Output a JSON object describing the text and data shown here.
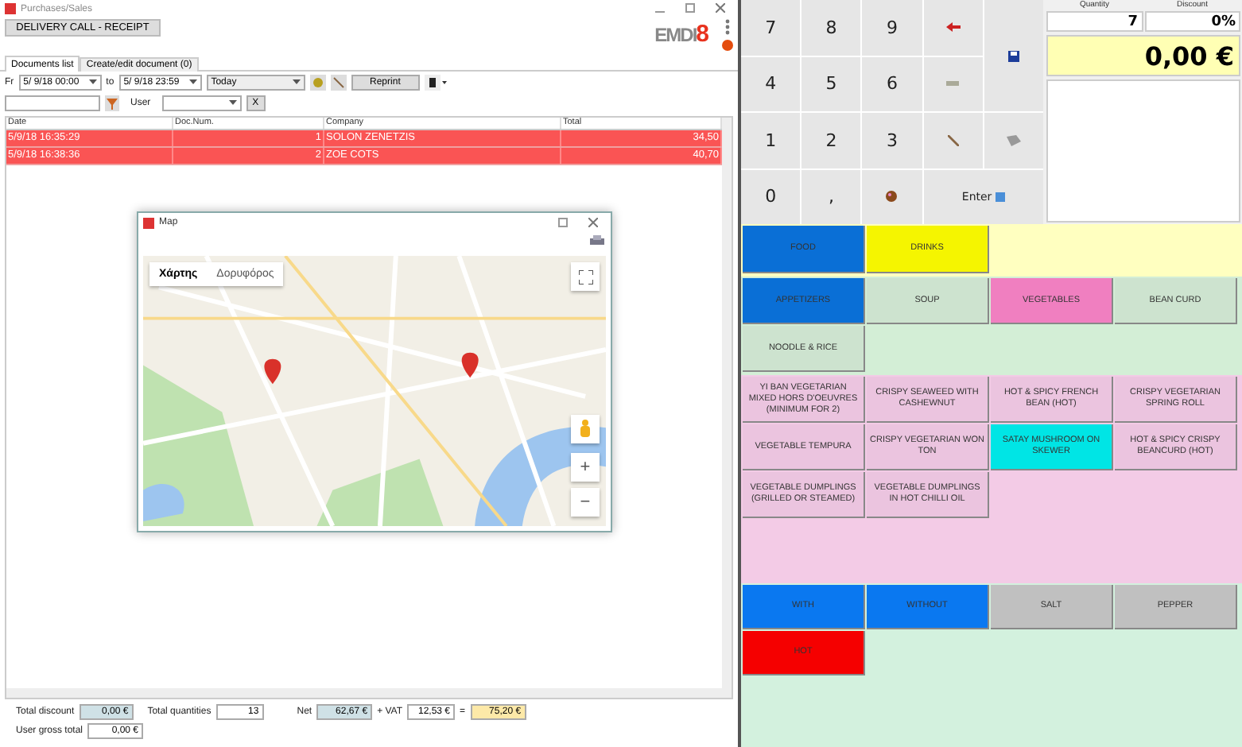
{
  "window": {
    "title": "Purchases/Sales"
  },
  "toolbar": {
    "action_button": "DELIVERY CALL - RECEIPT",
    "logo_text": "EMDI",
    "logo_digit": "8"
  },
  "tabs": [
    {
      "label": "Documents list",
      "selected": true
    },
    {
      "label": "Create/edit document (0)",
      "selected": false
    }
  ],
  "filter": {
    "from_label": "Fr",
    "from": "5/ 9/18 00:00",
    "to_label": "to",
    "to": "5/ 9/18 23:59",
    "period": "Today",
    "reprint": "Reprint",
    "user_label": "User",
    "clear": "X"
  },
  "table": {
    "columns": [
      "Date",
      "Doc.Num.",
      "Company",
      "Total"
    ],
    "rows": [
      {
        "cells": [
          "5/9/18 16:35:29",
          "1",
          "SOLON ZENETZIS",
          "34,50"
        ],
        "selected": true
      },
      {
        "cells": [
          "5/9/18 16:38:36",
          "2",
          "ZOE COTS",
          "40,70"
        ],
        "selected": true
      }
    ]
  },
  "totals": {
    "discount_label": "Total discount",
    "discount": "0,00 €",
    "quantities_label": "Total quantities",
    "quantities": "13",
    "net_label": "Net",
    "net": "62,67 €",
    "vat_label": "+ VAT",
    "vat": "12,53 €",
    "equals": "=",
    "total": "75,20 €",
    "user_gross_label": "User gross total",
    "user_gross": "0,00 €"
  },
  "map_dialog": {
    "title": "Map",
    "map_types": [
      {
        "label": "Χάρτης",
        "selected": true
      },
      {
        "label": "Δορυφόρος",
        "selected": false
      }
    ],
    "zoom_in": "+",
    "zoom_out": "−"
  },
  "keypad": {
    "keys": [
      {
        "kind": "text",
        "label": "7"
      },
      {
        "kind": "text",
        "label": "8"
      },
      {
        "kind": "text",
        "label": "9"
      },
      {
        "kind": "icon"
      },
      {
        "kind": "icon"
      },
      {
        "kind": "text",
        "label": "4"
      },
      {
        "kind": "text",
        "label": "5"
      },
      {
        "kind": "text",
        "label": "6"
      },
      {
        "kind": "icon"
      },
      {
        "kind": "text",
        "label": "1"
      },
      {
        "kind": "text",
        "label": "2"
      },
      {
        "kind": "text",
        "label": "3"
      },
      {
        "kind": "icon"
      },
      {
        "kind": "icon"
      },
      {
        "kind": "text",
        "label": "0"
      },
      {
        "kind": "text",
        "label": ","
      },
      {
        "kind": "icon"
      },
      {
        "kind": "enter",
        "label": "Enter"
      }
    ]
  },
  "order": {
    "quantity_label": "Quantity",
    "quantity": "7",
    "discount_label": "Discount",
    "discount": "0%",
    "amount": "0,00 €"
  },
  "groups": [
    {
      "label": "FOOD",
      "color": "#0a6fd6"
    },
    {
      "label": "DRINKS",
      "color": "#f5f500"
    }
  ],
  "categories": [
    {
      "label": "APPETIZERS",
      "color": "#0a6fd6"
    },
    {
      "label": "SOUP",
      "color": "#cde3cf"
    },
    {
      "label": "VEGETABLES",
      "color": "#f07fc0"
    },
    {
      "label": "BEAN CURD",
      "color": "#cde3cf"
    },
    {
      "label": "NOODLE & RICE",
      "color": "#cde3cf"
    }
  ],
  "products": [
    {
      "label": "YI BAN VEGETARIAN MIXED HORS D'OEUVRES (MINIMUM FOR 2)",
      "color": "#ebc4df"
    },
    {
      "label": "CRISPY SEAWEED WITH CASHEWNUT",
      "color": "#ebc4df"
    },
    {
      "label": "HOT & SPICY FRENCH BEAN (HOT)",
      "color": "#ebc4df"
    },
    {
      "label": "CRISPY VEGETARIAN SPRING ROLL",
      "color": "#ebc4df"
    },
    {
      "label": "VEGETABLE TEMPURA",
      "color": "#ebc4df"
    },
    {
      "label": "CRISPY VEGETARIAN WON TON",
      "color": "#ebc4df"
    },
    {
      "label": "SATAY MUSHROOM ON SKEWER",
      "color": "#00e5e5"
    },
    {
      "label": "HOT & SPICY CRISPY BEANCURD (HOT)",
      "color": "#ebc4df"
    },
    {
      "label": "VEGETABLE DUMPLINGS (GRILLED OR STEAMED)",
      "color": "#ebc4df"
    },
    {
      "label": "VEGETABLE DUMPLINGS IN HOT CHILLI OIL",
      "color": "#ebc4df"
    }
  ],
  "modifiers": [
    {
      "label": "WITH",
      "color": "#0a78f0"
    },
    {
      "label": "WITHOUT",
      "color": "#0a78f0"
    },
    {
      "label": "SALT",
      "color": "#c0c0c0"
    },
    {
      "label": "PEPPER",
      "color": "#c0c0c0"
    },
    {
      "label": "HOT",
      "color": "#f50000"
    }
  ]
}
